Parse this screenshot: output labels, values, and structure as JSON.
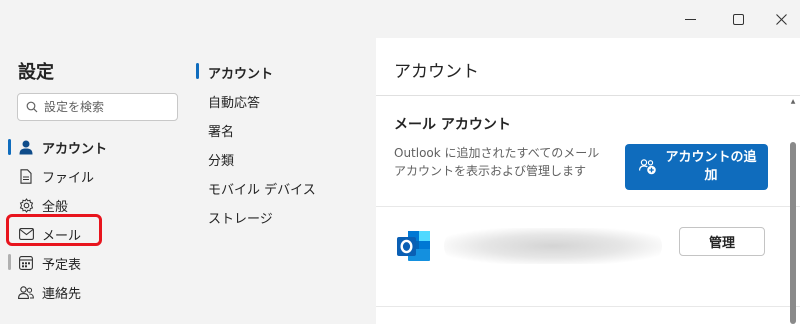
{
  "window": {
    "minimize_icon": "minimize-icon",
    "maximize_icon": "maximize-icon",
    "close_icon": "close-icon"
  },
  "nav": {
    "title": "設定",
    "search_placeholder": "設定を検索",
    "items": [
      {
        "label": "アカウント",
        "icon": "person-icon",
        "selected": true
      },
      {
        "label": "ファイル",
        "icon": "document-icon",
        "selected": false
      },
      {
        "label": "全般",
        "icon": "gear-icon",
        "selected": false
      },
      {
        "label": "メール",
        "icon": "mail-icon",
        "selected": false
      },
      {
        "label": "予定表",
        "icon": "calendar-icon",
        "selected": false
      },
      {
        "label": "連絡先",
        "icon": "people-icon",
        "selected": false
      }
    ]
  },
  "subnav": {
    "items": [
      {
        "label": "アカウント",
        "selected": true
      },
      {
        "label": "自動応答",
        "selected": false
      },
      {
        "label": "署名",
        "selected": false
      },
      {
        "label": "分類",
        "selected": false
      },
      {
        "label": "モバイル デバイス",
        "selected": false
      },
      {
        "label": "ストレージ",
        "selected": false
      }
    ]
  },
  "content": {
    "title": "アカウント",
    "section_title": "メール アカウント",
    "description": "Outlook に追加されたすべてのメール アカウントを表示および管理します",
    "add_button_label": "アカウントの追加",
    "manage_button_label": "管理"
  },
  "colors": {
    "accent": "#0f6cbd",
    "highlight": "#e8141d"
  }
}
